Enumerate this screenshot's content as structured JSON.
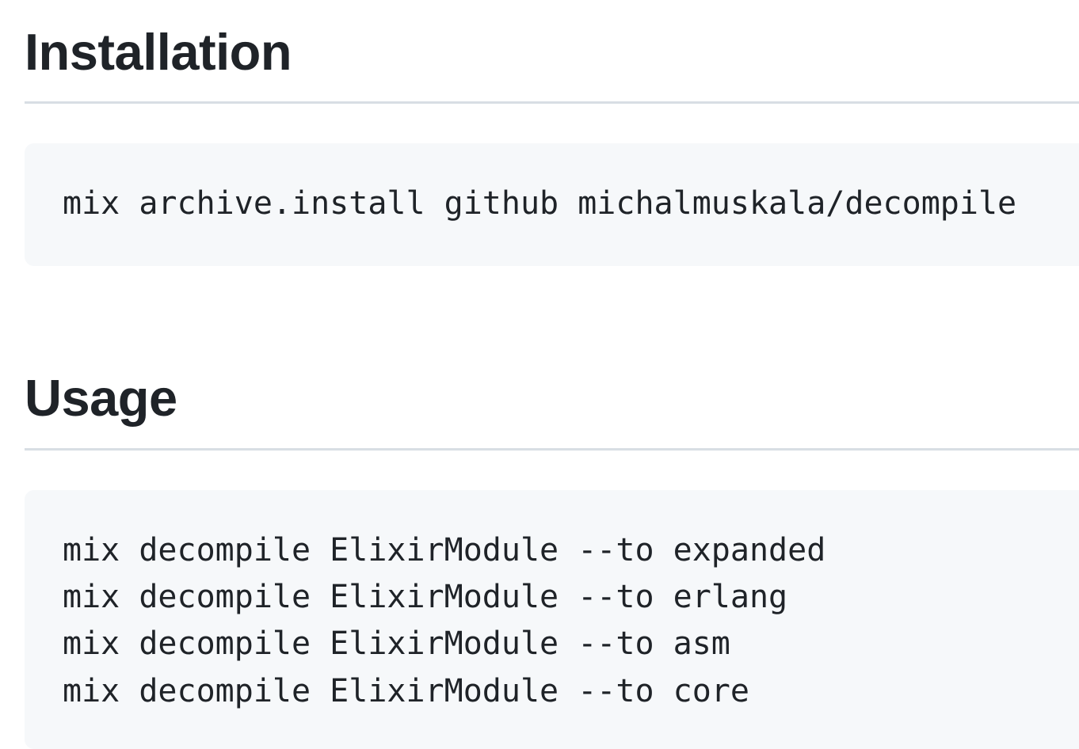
{
  "sections": [
    {
      "title": "Installation",
      "code_lines": [
        "mix archive.install github michalmuskala/decompile"
      ]
    },
    {
      "title": "Usage",
      "code_lines": [
        "mix decompile ElixirModule --to expanded",
        "mix decompile ElixirModule --to erlang",
        "mix decompile ElixirModule --to asm",
        "mix decompile ElixirModule --to core"
      ]
    }
  ],
  "colors": {
    "text": "#1f2328",
    "code_background": "#f6f8fa",
    "divider": "#d8dee4",
    "page_background": "#ffffff"
  }
}
